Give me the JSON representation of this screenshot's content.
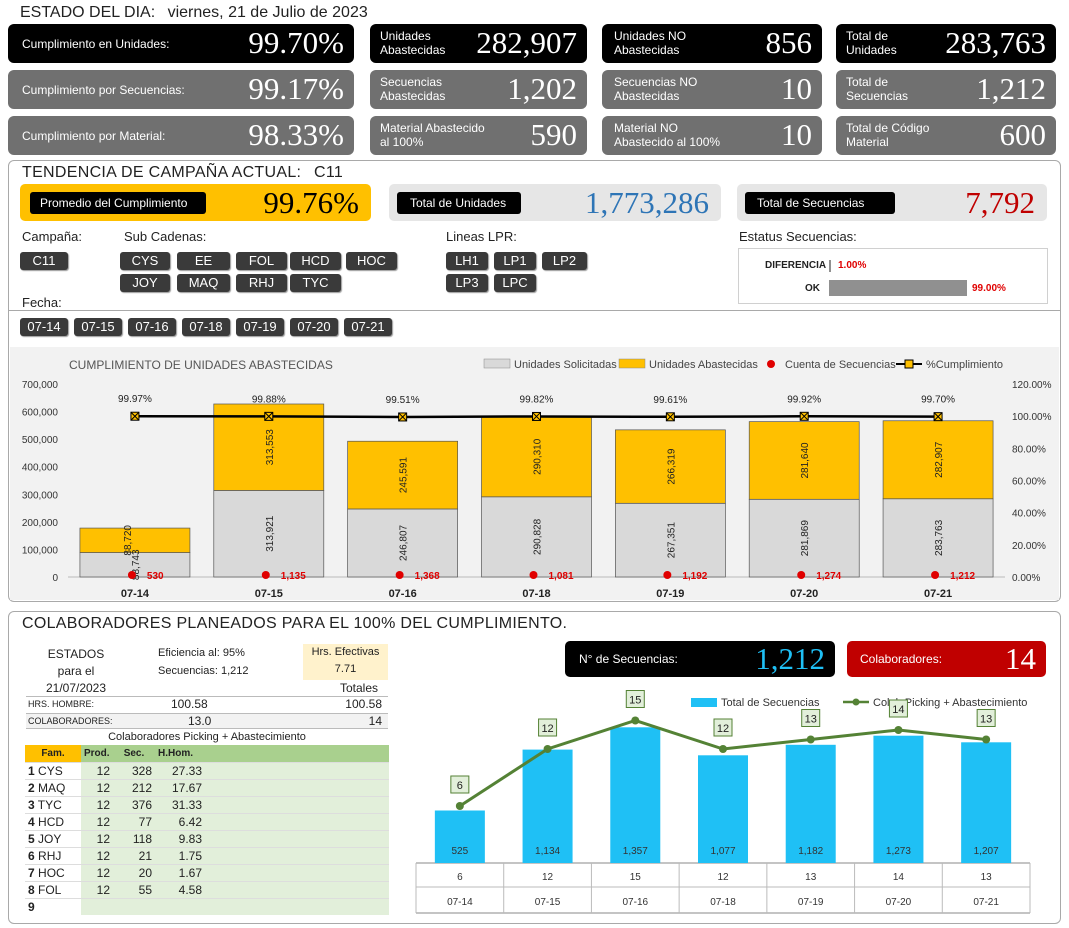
{
  "header": {
    "title": "ESTADO DEL DIA:",
    "date": "viernes, 21 de Julio de 2023"
  },
  "kpis": {
    "cumplimiento_unidades": {
      "label": "Cumplimiento en Unidades:",
      "value": "99.70%"
    },
    "cumplimiento_secuencias": {
      "label": "Cumplimiento por Secuencias:",
      "value": "99.17%"
    },
    "cumplimiento_material": {
      "label": "Cumplimiento por Material:",
      "value": "98.33%"
    },
    "unidades_abastecidas": {
      "label1": "Unidades",
      "label2": "Abastecidas",
      "value": "282,907"
    },
    "secuencias_abastecidas": {
      "label1": "Secuencias",
      "label2": "Abastecidas",
      "value": "1,202"
    },
    "material_abastecido": {
      "label1": "Material Abastecido",
      "label2": "al 100%",
      "value": "590"
    },
    "unidades_no": {
      "label1": "Unidades NO",
      "label2": "Abastecidas",
      "value": "856"
    },
    "secuencias_no": {
      "label1": "Secuencias NO",
      "label2": "Abastecidas",
      "value": "10"
    },
    "material_no": {
      "label1": "Material NO",
      "label2": "Abastecido al 100%",
      "value": "10"
    },
    "total_unidades": {
      "label1": "Total de",
      "label2": "Unidades",
      "value": "283,763"
    },
    "total_secuencias": {
      "label1": "Total de",
      "label2": "Secuencias",
      "value": "1,212"
    },
    "total_material": {
      "label1": "Total de Código",
      "label2": "Material",
      "value": "600"
    }
  },
  "tendencia": {
    "title": "TENDENCIA DE CAMPAÑA ACTUAL:",
    "campaign": "C11",
    "promedio_label": "Promedio  del Cumplimiento",
    "promedio_value": "99.76%",
    "total_unidades_label": "Total de Unidades",
    "total_unidades_value": "1,773,286",
    "total_secuencias_label": "Total de Secuencias",
    "total_secuencias_value": "7,792"
  },
  "slicers": {
    "campana_label": "Campaña:",
    "campana": [
      "C11"
    ],
    "subcadenas_label": "Sub Cadenas:",
    "subcadenas": [
      "CYS",
      "EE",
      "FOL",
      "HCD",
      "HOC",
      "JOY",
      "MAQ",
      "RHJ",
      "TYC"
    ],
    "lineas_label": "Lineas LPR:",
    "lineas": [
      "LH1",
      "LP1",
      "LP2",
      "LP3",
      "LPC"
    ],
    "estatus_label": "Estatus Secuencias:",
    "fecha_label": "Fecha:",
    "fechas": [
      "07-14",
      "07-15",
      "07-16",
      "07-18",
      "07-19",
      "07-20",
      "07-21"
    ]
  },
  "estatus": {
    "rows": [
      {
        "label": "DIFERENCIA",
        "value": "1.00%",
        "pct": 0.01
      },
      {
        "label": "OK",
        "value": "99.00%",
        "pct": 0.99
      }
    ]
  },
  "colors": {
    "yellow": "#ffc000",
    "gray": "#d9d9d9",
    "blue": "#1fc0f5",
    "green": "#548235",
    "red": "#e00000",
    "navy": "#2e75b6",
    "darkred": "#c00000"
  },
  "chart_data": [
    {
      "type": "bar",
      "title": "CUMPLIMIENTO DE UNIDADES ABASTECIDAS",
      "categories": [
        "07-14",
        "07-15",
        "07-16",
        "07-18",
        "07-19",
        "07-20",
        "07-21"
      ],
      "legend": [
        "Unidades Solicitadas",
        "Unidades Abastecidas",
        "Cuenta de Secuencias",
        "%Cumplimiento"
      ],
      "series": [
        {
          "name": "Unidades Solicitadas",
          "values": [
            88743,
            313921,
            246807,
            290828,
            267351,
            281869,
            283763
          ],
          "labels": [
            "88,743",
            "313,921",
            "246,807",
            "290,828",
            "267,351",
            "281,869",
            "283,763"
          ]
        },
        {
          "name": "Unidades Abastecidas",
          "values": [
            88720,
            313553,
            245591,
            290310,
            266319,
            281640,
            282907
          ],
          "labels": [
            "88,720",
            "313,553",
            "245,591",
            "290,310",
            "266,319",
            "281,640",
            "282,907"
          ]
        },
        {
          "name": "Cuenta de Secuencias",
          "values": [
            530,
            1135,
            1368,
            1081,
            1192,
            1274,
            1212
          ],
          "labels": [
            "530",
            "1,135",
            "1,368",
            "1,081",
            "1,192",
            "1,274",
            "1,212"
          ]
        },
        {
          "name": "%Cumplimiento",
          "values": [
            99.97,
            99.88,
            99.51,
            99.82,
            99.61,
            99.92,
            99.7
          ],
          "labels": [
            "99.97%",
            "99.88%",
            "99.51%",
            "99.82%",
            "99.61%",
            "99.92%",
            "99.70%"
          ]
        }
      ],
      "yticks": [
        "0",
        "100,000",
        "200,000",
        "300,000",
        "400,000",
        "500,000",
        "600,000",
        "700,000"
      ],
      "y2ticks": [
        "0.00%",
        "20.00%",
        "40.00%",
        "60.00%",
        "80.00%",
        "100.00%",
        "120.00%"
      ],
      "ylim": [
        0,
        700000
      ],
      "y2lim": [
        0,
        120
      ]
    },
    {
      "type": "bar",
      "legend": [
        "Total de Secuencias",
        "Colab.Picking + Abastecimiento"
      ],
      "categories": [
        "07-14",
        "07-15",
        "07-16",
        "07-18",
        "07-19",
        "07-20",
        "07-21"
      ],
      "series": [
        {
          "name": "Total de Secuencias",
          "values": [
            525,
            1134,
            1357,
            1077,
            1182,
            1273,
            1207
          ],
          "labels": [
            "525",
            "1,134",
            "1,357",
            "1,077",
            "1,182",
            "1,273",
            "1,207"
          ]
        },
        {
          "name": "Colab.Picking + Abastecimiento",
          "values": [
            6,
            12,
            15,
            12,
            13,
            14,
            13
          ],
          "labels": [
            "6",
            "12",
            "15",
            "12",
            "13",
            "14",
            "13"
          ]
        }
      ],
      "ylim": [
        0,
        1700
      ],
      "y2lim": [
        0,
        20
      ]
    }
  ],
  "colaboradores": {
    "title": "COLABORADORES PLANEADOS PARA EL 100% DEL CUMPLIMIENTO.",
    "estados_label": "ESTADOS",
    "para_el": "para el",
    "fecha": "21/07/2023",
    "eficiencia_label": "Eficiencia al:",
    "eficiencia_value": "95%",
    "secuencias_label": "Secuencias:",
    "secuencias_value": "1,212",
    "hrs_efectivas_label": "Hrs. Efectivas",
    "hrs_efectivas_value": "7.71",
    "totales_label": "Totales",
    "hrs_hombre_label": "HRS. HOMBRE:",
    "hrs_hombre_value": "100.58",
    "hrs_hombre_total": "100.58",
    "colaboradores_label": "COLABORADORES:",
    "colaboradores_value": "13.0",
    "colaboradores_total": "14",
    "subtitle": "Colaboradores Picking + Abastecimiento",
    "cols": [
      "Fam.",
      "Prod.",
      "Sec.",
      "H.Hom."
    ],
    "rows": [
      [
        "1",
        "CYS",
        "12",
        "328",
        "27.33"
      ],
      [
        "2",
        "MAQ",
        "12",
        "212",
        "17.67"
      ],
      [
        "3",
        "TYC",
        "12",
        "376",
        "31.33"
      ],
      [
        "4",
        "HCD",
        "12",
        "77",
        "6.42"
      ],
      [
        "5",
        "JOY",
        "12",
        "118",
        "9.83"
      ],
      [
        "6",
        "RHJ",
        "12",
        "21",
        "1.75"
      ],
      [
        "7",
        "HOC",
        "12",
        "20",
        "1.67"
      ],
      [
        "8",
        "FOL",
        "12",
        "55",
        "4.58"
      ],
      [
        "9",
        "",
        "",
        "",
        ""
      ]
    ],
    "num_secuencias_label": "N° de Secuencias:",
    "num_secuencias_value": "1,212",
    "colab_label": "Colaboradores:",
    "colab_value": "14"
  }
}
